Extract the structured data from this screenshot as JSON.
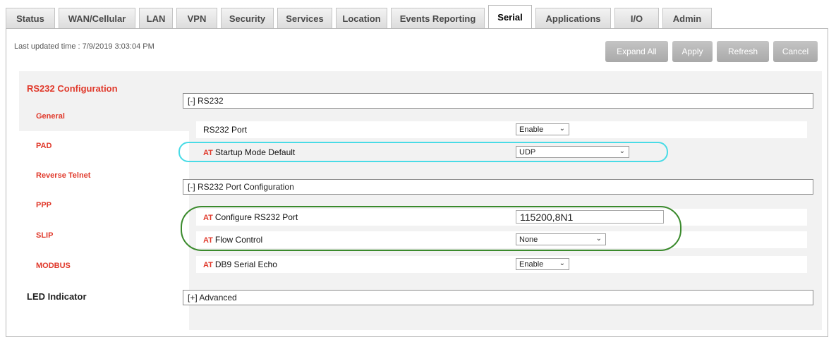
{
  "tabs": [
    {
      "label": "Status",
      "active": false
    },
    {
      "label": "WAN/Cellular",
      "active": false
    },
    {
      "label": "LAN",
      "active": false
    },
    {
      "label": "VPN",
      "active": false
    },
    {
      "label": "Security",
      "active": false
    },
    {
      "label": "Services",
      "active": false
    },
    {
      "label": "Location",
      "active": false
    },
    {
      "label": "Events Reporting",
      "active": false
    },
    {
      "label": "Serial",
      "active": true
    },
    {
      "label": "Applications",
      "active": false
    },
    {
      "label": "I/O",
      "active": false
    },
    {
      "label": "Admin",
      "active": false
    }
  ],
  "header": {
    "last_updated": "Last updated time : 7/9/2019 3:03:04 PM",
    "buttons": {
      "expand_all": "Expand All",
      "apply": "Apply",
      "refresh": "Refresh",
      "cancel": "Cancel"
    }
  },
  "sidebar": {
    "group_title": "RS232 Configuration",
    "items": [
      {
        "label": "General",
        "selected": true
      },
      {
        "label": "PAD",
        "selected": false
      },
      {
        "label": "Reverse Telnet",
        "selected": false
      },
      {
        "label": "PPP",
        "selected": false
      },
      {
        "label": "SLIP",
        "selected": false
      },
      {
        "label": "MODBUS",
        "selected": false
      }
    ],
    "led_indicator": "LED Indicator"
  },
  "main": {
    "rs232": {
      "header": "[-] RS232",
      "port_label": "RS232 Port",
      "port_value": "Enable",
      "startup_at": "AT",
      "startup_label": "Startup Mode Default",
      "startup_value": "UDP"
    },
    "port_config": {
      "header": "[-] RS232 Port Configuration",
      "configure_at": "AT",
      "configure_label": "Configure RS232 Port",
      "configure_value": "115200,8N1",
      "flow_at": "AT",
      "flow_label": "Flow Control",
      "flow_value": "None",
      "echo_at": "AT",
      "echo_label": "DB9 Serial Echo",
      "echo_value": "Enable"
    },
    "advanced": {
      "header": "[+] Advanced"
    }
  },
  "colors": {
    "accent_red": "#e0392b",
    "highlight_cyan": "#49dbe6",
    "highlight_green": "#3a8a2c",
    "button_gray": "#b5b5b5"
  },
  "icons": {
    "dropdown": "chevron-down-icon"
  }
}
